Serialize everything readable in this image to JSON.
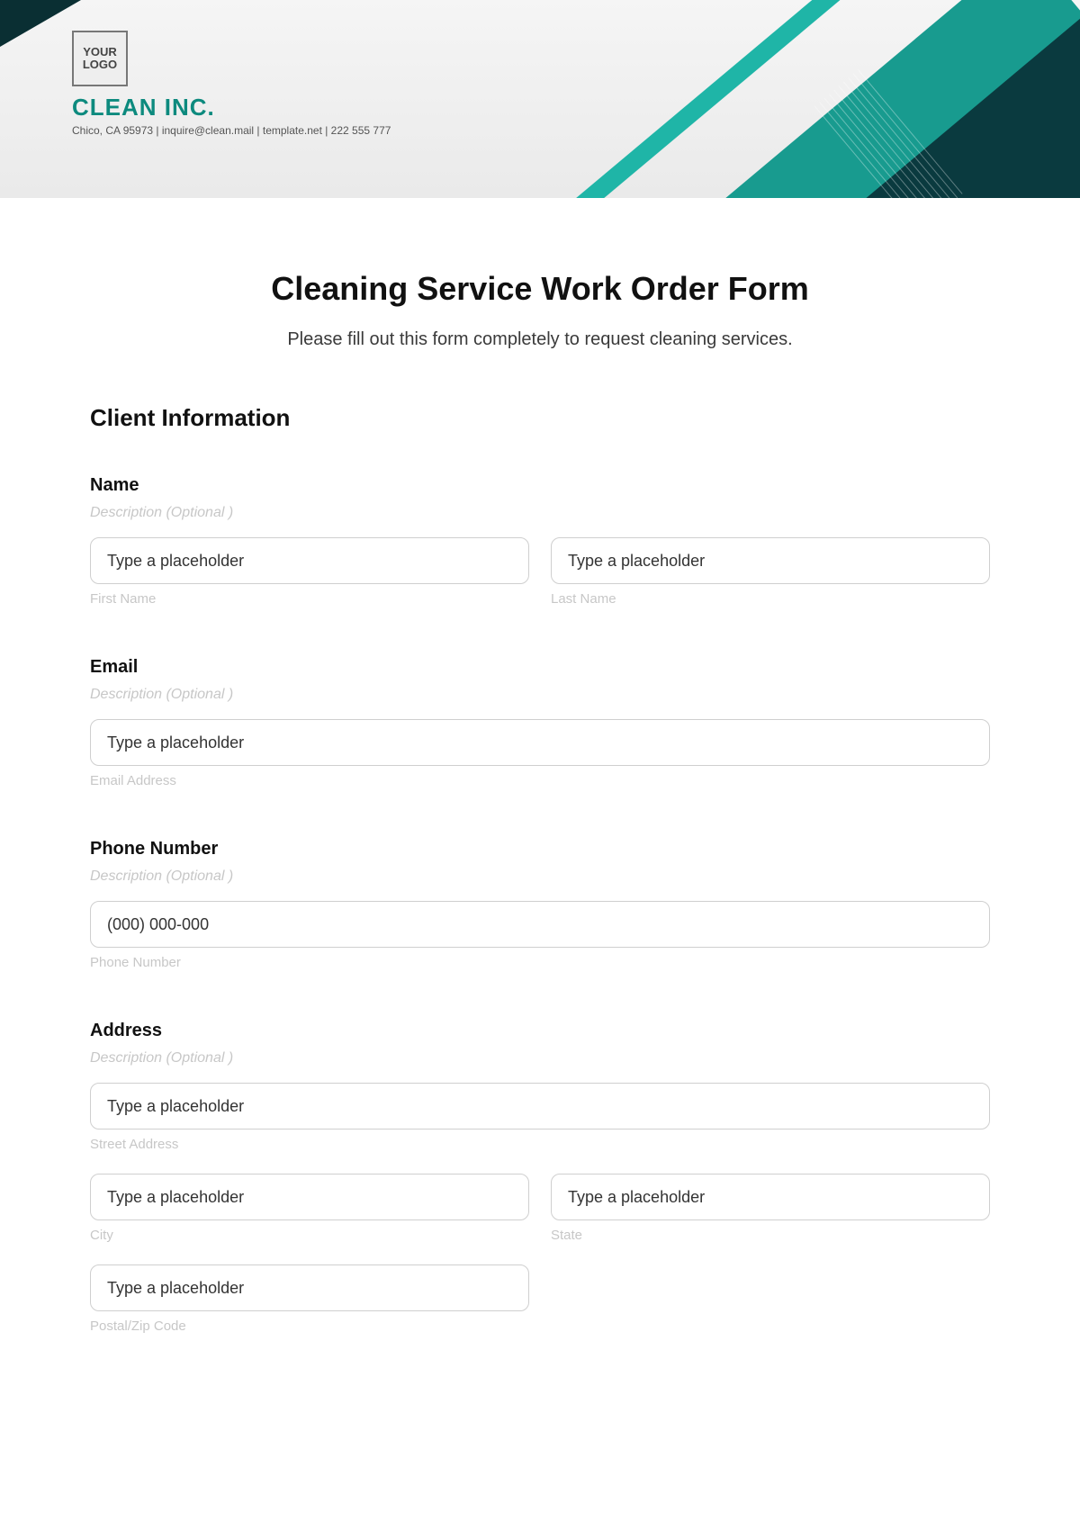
{
  "header": {
    "logo_text": "YOUR LOGO",
    "company_name": "CLEAN INC.",
    "contact_line": "Chico, CA 95973 | inquire@clean.mail | template.net | 222 555 777"
  },
  "form": {
    "title": "Cleaning Service Work Order Form",
    "subtitle": "Please fill out this form completely to request cleaning services.",
    "section_heading": "Client Information",
    "name": {
      "label": "Name",
      "desc": "Description (Optional )",
      "first_placeholder": "Type a placeholder",
      "first_sub": "First Name",
      "last_placeholder": "Type a placeholder",
      "last_sub": "Last Name"
    },
    "email": {
      "label": "Email",
      "desc": "Description (Optional )",
      "placeholder": "Type a placeholder",
      "sub": "Email Address"
    },
    "phone": {
      "label": "Phone Number",
      "desc": "Description (Optional )",
      "placeholder": "(000) 000-000",
      "sub": "Phone Number"
    },
    "address": {
      "label": "Address",
      "desc": "Description (Optional )",
      "street_placeholder": "Type a placeholder",
      "street_sub": "Street Address",
      "city_placeholder": "Type a placeholder",
      "city_sub": "City",
      "state_placeholder": "Type a placeholder",
      "state_sub": "State",
      "zip_placeholder": "Type a placeholder",
      "zip_sub": "Postal/Zip Code"
    }
  }
}
